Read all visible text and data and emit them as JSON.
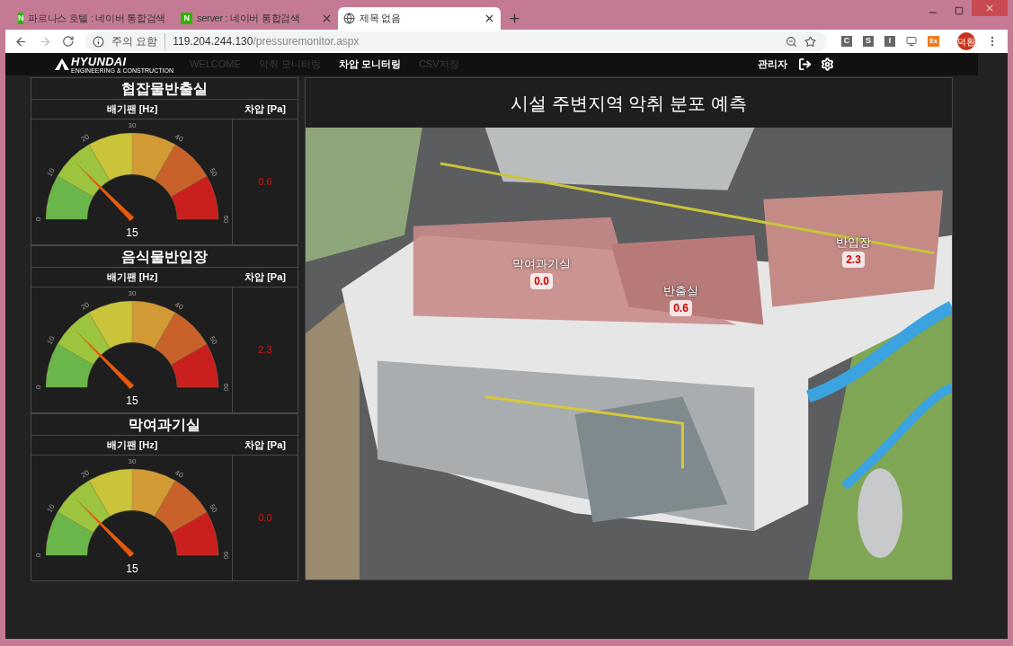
{
  "browser": {
    "tabs": [
      {
        "kind": "naver",
        "icon": "N",
        "title": "파르나스 호텔 : 네이버 통합검색",
        "selected": false
      },
      {
        "kind": "naver",
        "icon": "N",
        "title": "server : 네이버 통합검색",
        "selected": false
      },
      {
        "kind": "globe",
        "title": "제목 없음",
        "selected": true
      }
    ],
    "address": {
      "security": "주의 요함",
      "host": "119.204.244.130",
      "path": "/pressuremonitor.aspx"
    },
    "extensions": [
      {
        "kind": "letter",
        "label": "C"
      },
      {
        "kind": "letter",
        "label": "S"
      },
      {
        "kind": "letter",
        "label": "I"
      },
      {
        "kind": "screen"
      },
      {
        "kind": "orange",
        "label": "Ex"
      }
    ],
    "profile": "덕환"
  },
  "nav": {
    "logo": "HYUNDAI",
    "logo_sub": "ENGINEERING & CONSTRUCTION",
    "items": [
      {
        "label": "WELCOME",
        "selected": false
      },
      {
        "label": "악취 모니터링",
        "selected": false
      },
      {
        "label": "차압 모니터링",
        "selected": true
      },
      {
        "label": "CSV저장",
        "selected": false
      }
    ],
    "user": "관리자"
  },
  "cards": [
    {
      "title": "협잡물반출실",
      "fan_header": "배기팬 [Hz]",
      "pressure_header": "차압 [Pa]",
      "gauge": {
        "reading": "15",
        "ticks": [
          "0",
          "10",
          "20",
          "30",
          "40",
          "50",
          "60"
        ]
      },
      "pressure": "0.6"
    },
    {
      "title": "음식물반입장",
      "fan_header": "배기팬 [Hz]",
      "pressure_header": "차압 [Pa]",
      "gauge": {
        "reading": "15",
        "ticks": [
          "0",
          "10",
          "20",
          "30",
          "40",
          "50",
          "60"
        ]
      },
      "pressure": "2.3"
    },
    {
      "title": "막여과기실",
      "fan_header": "배기팬 [Hz]",
      "pressure_header": "차압 [Pa]",
      "gauge": {
        "reading": "15",
        "ticks": [
          "0",
          "10",
          "20",
          "30",
          "40",
          "50",
          "60"
        ]
      },
      "pressure": "0.0"
    }
  ],
  "map": {
    "title": "시설 주변지역 악취 분포 예측",
    "labels": [
      {
        "name": "막여과기실",
        "value": "0.0"
      },
      {
        "name": "반출실",
        "value": "0.6"
      },
      {
        "name": "반입장",
        "value": "2.3"
      }
    ]
  }
}
